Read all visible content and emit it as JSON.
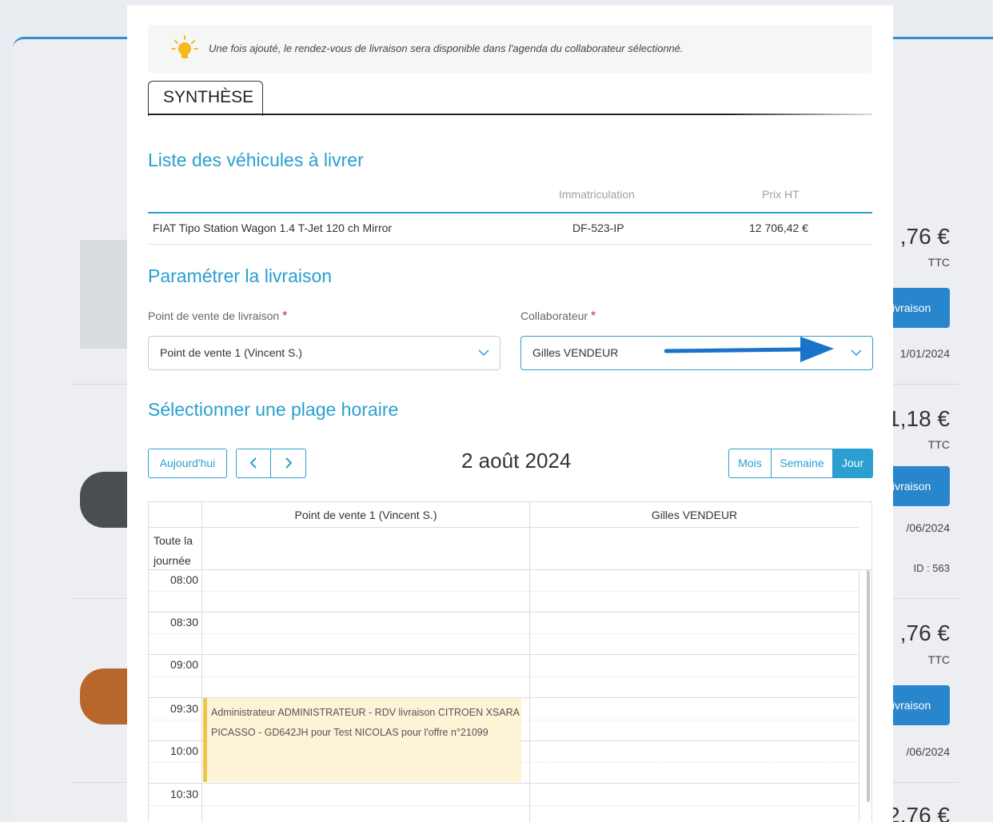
{
  "background": {
    "cards": [
      {
        "price": ",76 €",
        "ttc": "TTC",
        "button": "ivraison",
        "date": "1/01/2024",
        "id": ""
      },
      {
        "price": "1,18 €",
        "ttc": "TTC",
        "button": "ivraison",
        "date": "/06/2024",
        "id": "ID : 563"
      },
      {
        "price": ",76 €",
        "ttc": "TTC",
        "button": "ivraison",
        "date": "/06/2024",
        "id": ""
      },
      {
        "price": "2,76 €"
      }
    ]
  },
  "info": {
    "text": "Une fois ajouté, le rendez-vous de livraison sera disponible dans l'agenda du collaborateur sélectionné.",
    "icon": "lightbulb-icon"
  },
  "tab": {
    "label": "SYNTHÈSE"
  },
  "vehicles": {
    "title": "Liste des véhicules à livrer",
    "headers": {
      "immat": "Immatriculation",
      "price": "Prix HT"
    },
    "rows": [
      {
        "name": "FIAT Tipo Station Wagon 1.4 T-Jet 120 ch Mirror",
        "immat": "DF-523-IP",
        "price": "12 706,42 €"
      }
    ]
  },
  "delivery": {
    "title": "Paramétrer la livraison",
    "point_label": "Point de vente de livraison",
    "point_value": "Point de vente 1 (Vincent S.)",
    "collab_label": "Collaborateur",
    "collab_value": "Gilles VENDEUR",
    "required_mark": "*"
  },
  "schedule": {
    "title": "Sélectionner une plage horaire",
    "today": "Aujourd'hui",
    "prev": "‹",
    "next": "›",
    "date": "2 août 2024",
    "views": {
      "month": "Mois",
      "week": "Semaine",
      "day": "Jour"
    },
    "columns": [
      "Point de vente 1 (Vincent S.)",
      "Gilles VENDEUR"
    ],
    "allday_line1": "Toute la",
    "allday_line2": "journée",
    "times": [
      "08:00",
      "08:30",
      "09:00",
      "09:30",
      "10:00",
      "10:30"
    ],
    "event": {
      "line1": "Administrateur ADMINISTRATEUR - RDV livraison CITROEN XSARA",
      "line2": "PICASSO - GD642JH pour Test NICOLAS pour l'offre n°21099"
    }
  },
  "colors": {
    "accent": "#2a9fd0",
    "event_bg": "#fdf3d6",
    "arrow": "#1a73c8"
  }
}
